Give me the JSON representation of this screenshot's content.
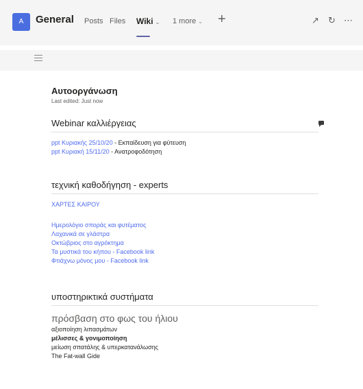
{
  "header": {
    "team_avatar": "A",
    "channel": "General",
    "tabs": [
      {
        "label": "Posts"
      },
      {
        "label": "Files"
      },
      {
        "label": "Wiki"
      },
      {
        "label": "1 more"
      }
    ],
    "add_tab": "+",
    "icons": [
      "expand-icon",
      "refresh-icon",
      "more-icon"
    ]
  },
  "wiki": {
    "page_title": "Αυτοοργάνωση",
    "last_edited": "Last edited: Just now",
    "sections": [
      {
        "title": "Webinar καλλιέργειας",
        "lines": [
          {
            "link": "ppt Κυριακής 25/10/20",
            "text": " - Εκπαίδευση για φύτευση"
          },
          {
            "link": "ppt Κυριακή 15/11/20",
            "text": " - Ανατροφοδότηση"
          }
        ]
      },
      {
        "title": "τεχνική καθοδήγηση - experts",
        "link_top": "ΧΑΡΤΕΣ ΚΑΙΡΟΥ",
        "links": [
          "Ημερολόγιο σποράς και φυτέματος",
          "Λαχανικά σε γλάστρα",
          "Οκτώβριος στο αγρόκτημα",
          "Τα μυστικά του κήπου - Facebook link",
          "Φτιάχνω μόνος μου - Facebook link"
        ]
      },
      {
        "title": "υποστηρικτικά συστήματα",
        "subtitle": "πρόσβαση στο φως του ήλιου",
        "items": [
          {
            "text": "αξιοποίηση λιπασμάτων"
          },
          {
            "text": "μέλισσες & γονιμοποίηση"
          },
          {
            "text": "μείωση σπατάλης & υπερκατανάλωσης"
          },
          {
            "text": "The Fat-wall Gide"
          }
        ]
      }
    ]
  }
}
